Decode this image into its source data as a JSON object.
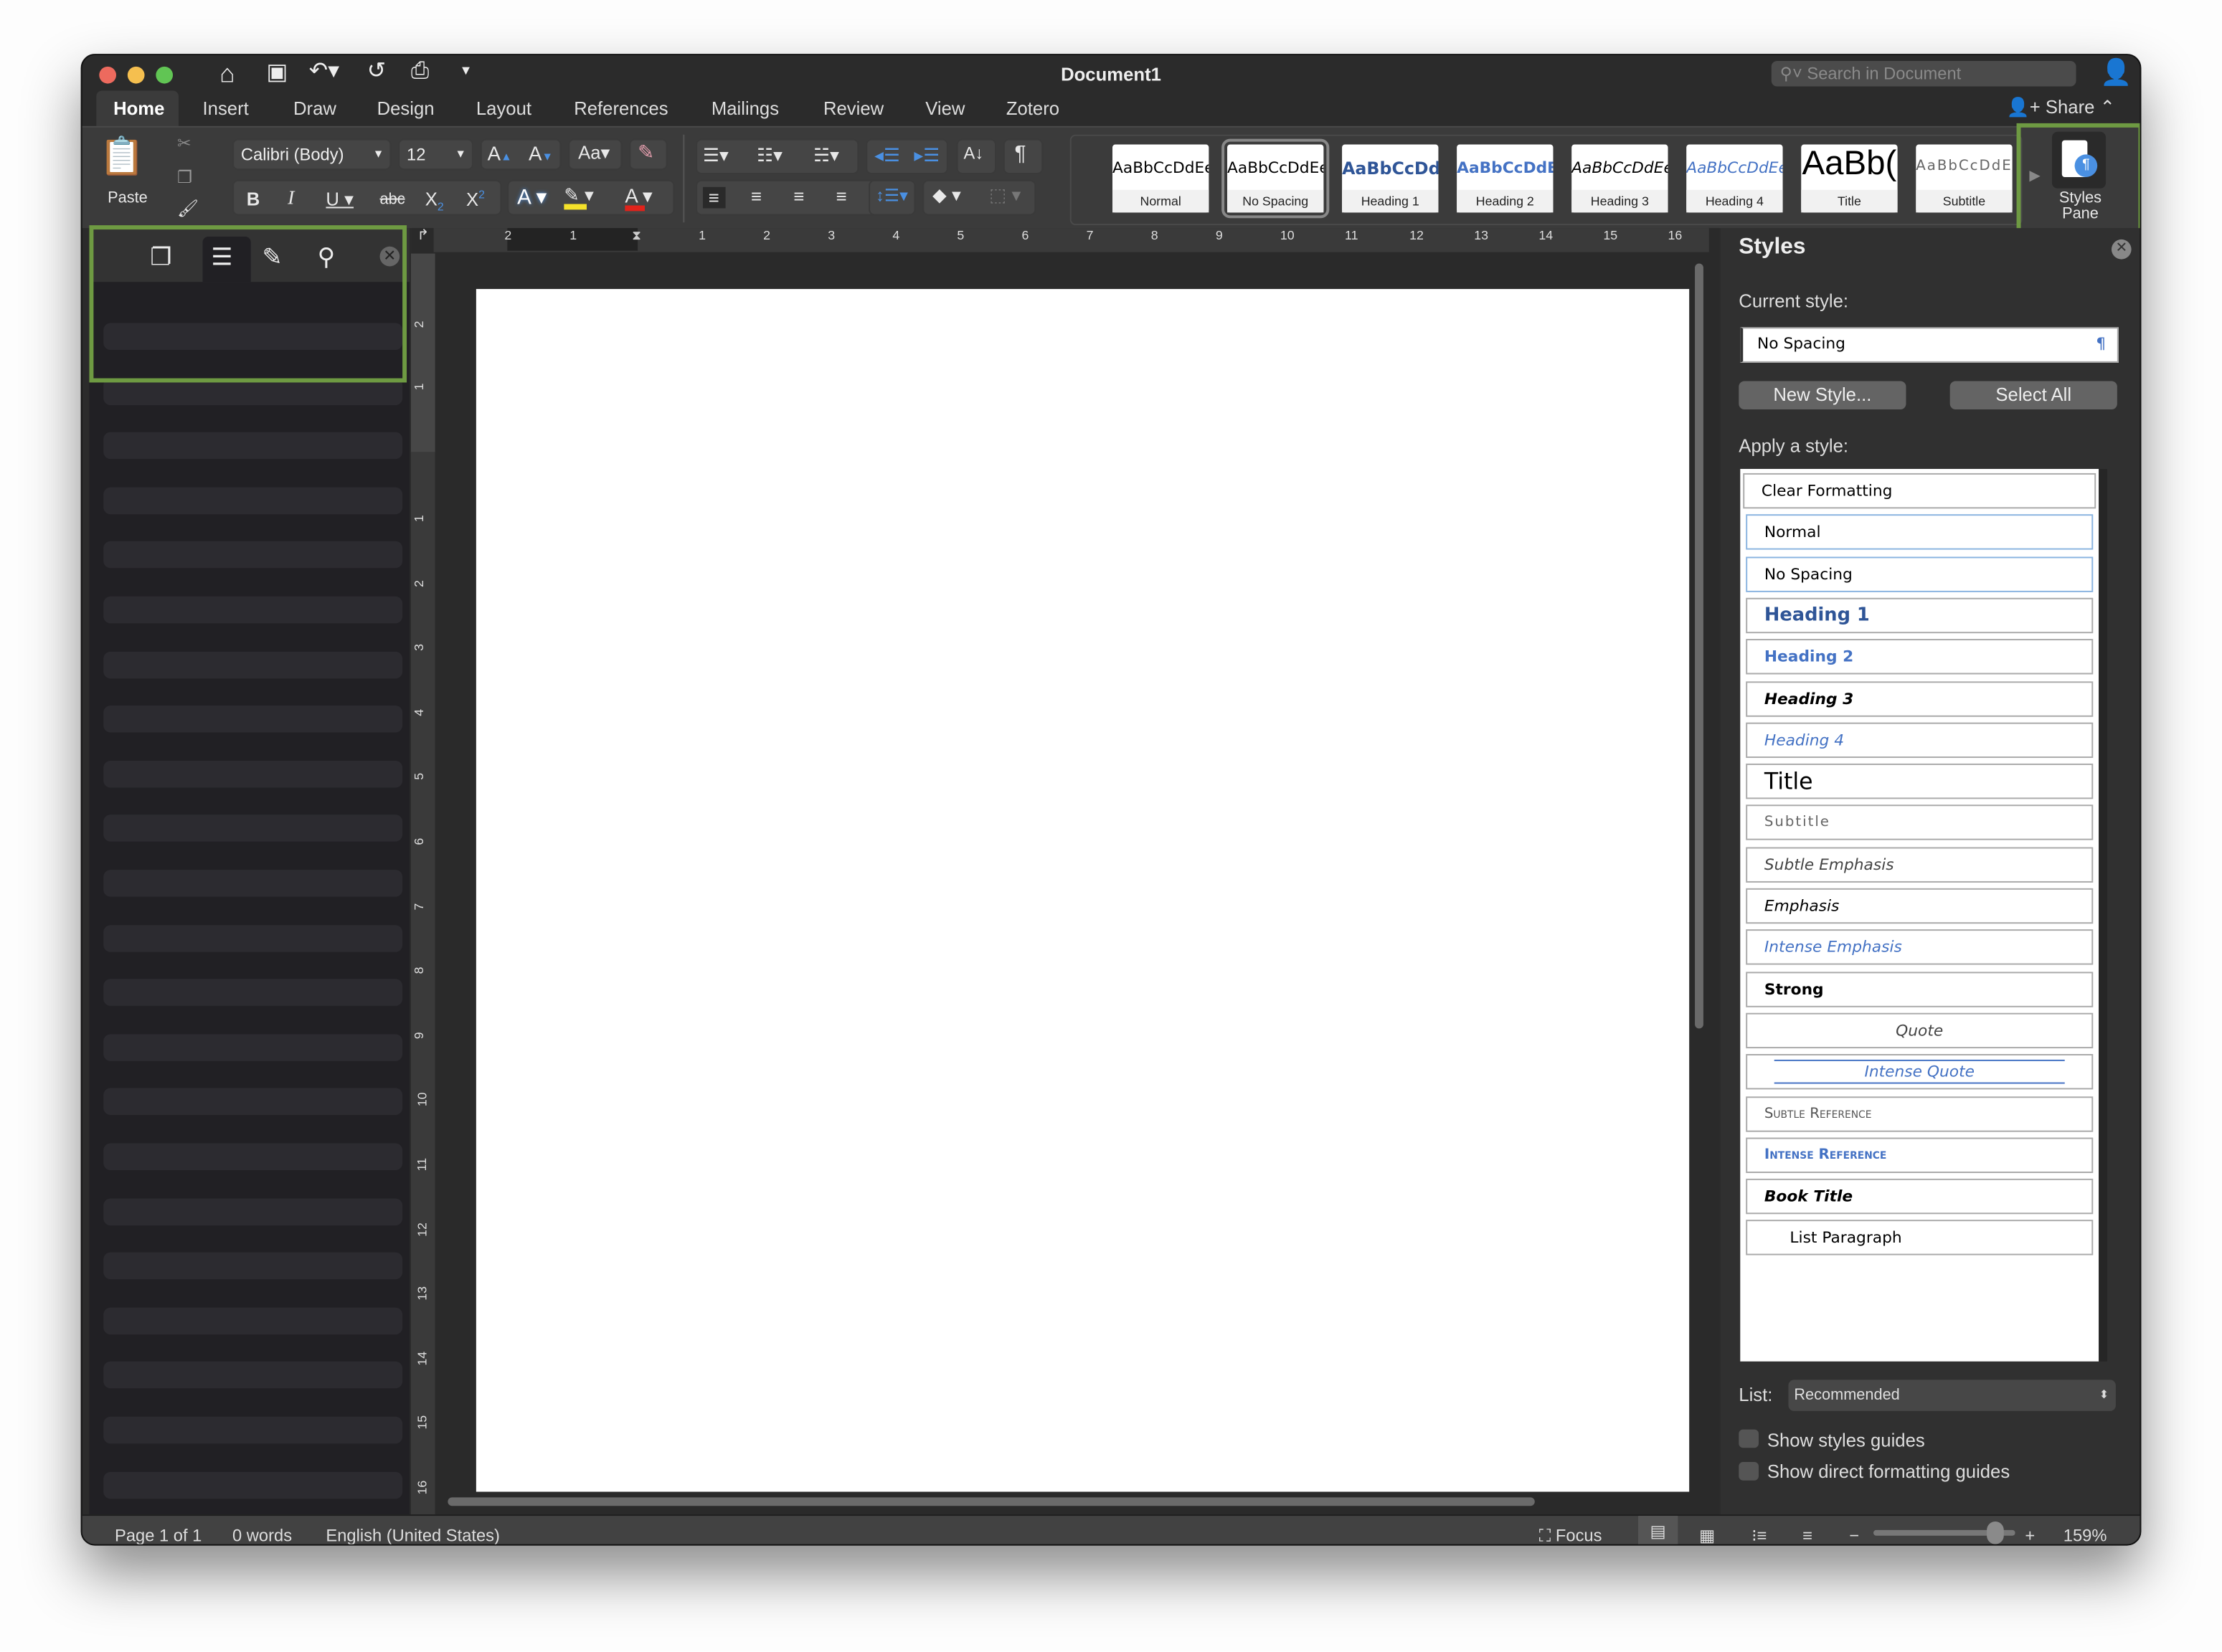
{
  "window": {
    "title": "Document1",
    "search_placeholder": "Search in Document",
    "share_label": "Share"
  },
  "tabs": [
    "Home",
    "Insert",
    "Draw",
    "Design",
    "Layout",
    "References",
    "Mailings",
    "Review",
    "View",
    "Zotero"
  ],
  "active_tab": "Home",
  "ribbon": {
    "paste_label": "Paste",
    "font_name": "Calibri (Body)",
    "font_size": "12",
    "styles_pane_label_1": "Styles",
    "styles_pane_label_2": "Pane",
    "highlight_color": "#f5e22a",
    "font_color": "#e0231b"
  },
  "gallery": [
    {
      "sample": "AaBbCcDdEe",
      "name": "Normal"
    },
    {
      "sample": "AaBbCcDdEe",
      "name": "No Spacing"
    },
    {
      "sample": "AaBbCcDdI",
      "name": "Heading 1"
    },
    {
      "sample": "AaBbCcDdEe",
      "name": "Heading 2"
    },
    {
      "sample": "AaBbCcDdEe",
      "name": "Heading 3"
    },
    {
      "sample": "AaBbCcDdEe",
      "name": "Heading 4"
    },
    {
      "sample": "AaBb(",
      "name": "Title"
    },
    {
      "sample": "AaBbCcDdEe",
      "name": "Subtitle"
    }
  ],
  "ruler": {
    "left": [
      "2",
      "1"
    ],
    "right": [
      "1",
      "2",
      "3",
      "4",
      "5",
      "6",
      "7",
      "8",
      "9",
      "10",
      "11",
      "12",
      "13",
      "14",
      "15",
      "16"
    ],
    "vtop": [
      "2",
      "1"
    ],
    "vmain": [
      "1",
      "2",
      "3",
      "4",
      "5",
      "6",
      "7",
      "8",
      "9",
      "10",
      "11",
      "12",
      "13",
      "14",
      "15",
      "16"
    ]
  },
  "styles_pane": {
    "title": "Styles",
    "current_label": "Current style:",
    "current_value": "No Spacing",
    "new_style": "New Style...",
    "select_all": "Select All",
    "apply_label": "Apply a style:",
    "items": [
      "Clear Formatting",
      "Normal",
      "No Spacing",
      "Heading 1",
      "Heading 2",
      "Heading 3",
      "Heading 4",
      "Title",
      "Subtitle",
      "Subtle Emphasis",
      "Emphasis",
      "Intense Emphasis",
      "Strong",
      "Quote",
      "Intense Quote",
      "Subtle Reference",
      "Intense Reference",
      "Book Title",
      "List Paragraph"
    ],
    "list_label": "List:",
    "list_value": "Recommended",
    "show_styles_guides": "Show styles guides",
    "show_direct_guides": "Show direct formatting guides",
    "accent": "#4472c4"
  },
  "status": {
    "page": "Page 1 of 1",
    "words": "0 words",
    "language": "English (United States)",
    "focus": "Focus",
    "zoom": "159%",
    "zoom_level_percent": 159
  }
}
